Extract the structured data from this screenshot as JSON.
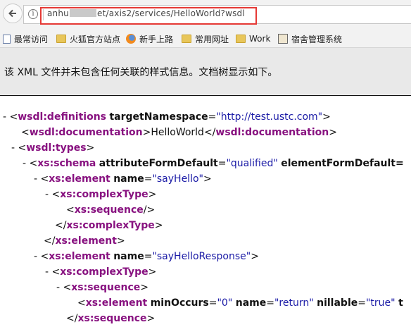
{
  "browser": {
    "url_prefix": "anhu",
    "url_suffix": "et/axis2/services/HelloWorld?wsdl"
  },
  "bookmarks": [
    {
      "label": "最常访问",
      "icon": "page-icon"
    },
    {
      "label": "火狐官方站点",
      "icon": "folder-icon"
    },
    {
      "label": "新手上路",
      "icon": "firefox-icon"
    },
    {
      "label": "常用网址",
      "icon": "folder-icon"
    },
    {
      "label": "Work",
      "icon": "folder-icon"
    },
    {
      "label": "宿舍管理系统",
      "icon": "dorm-icon"
    }
  ],
  "notice": "该 XML 文件并未包含任何关联的样式信息。文档树显示如下。",
  "xml": {
    "l1": {
      "toggle": "-",
      "open": "<",
      "tag": "wsdl:definitions",
      "a1n": "targetNamespace",
      "eq": "=",
      "a1v": "\"http://test.ustc.com\"",
      "close": ">"
    },
    "l2": {
      "open": "<",
      "tag": "wsdl:documentation",
      "gt": ">",
      "text": "HelloWorld",
      "open2": "</",
      "tag2": "wsdl:documentation",
      "close": ">"
    },
    "l3": {
      "toggle": "-",
      "open": "<",
      "tag": "wsdl:types",
      "close": ">"
    },
    "l4": {
      "toggle": "-",
      "open": "<",
      "tag": "xs:schema",
      "a1n": "attributeFormDefault",
      "eq": "=",
      "a1v": "\"qualified\"",
      "a2n": "elementFormDefault="
    },
    "l5": {
      "toggle": "-",
      "open": "<",
      "tag": "xs:element",
      "a1n": "name",
      "eq": "=",
      "a1v": "\"sayHello\"",
      "close": ">"
    },
    "l6": {
      "toggle": "-",
      "open": "<",
      "tag": "xs:complexType",
      "close": ">"
    },
    "l7": {
      "open": "<",
      "tag": "xs:sequence",
      "close": "/>"
    },
    "l8": {
      "open": "</",
      "tag": "xs:complexType",
      "close": ">"
    },
    "l9": {
      "open": "</",
      "tag": "xs:element",
      "close": ">"
    },
    "l10": {
      "toggle": "-",
      "open": "<",
      "tag": "xs:element",
      "a1n": "name",
      "eq": "=",
      "a1v": "\"sayHelloResponse\"",
      "close": ">"
    },
    "l11": {
      "toggle": "-",
      "open": "<",
      "tag": "xs:complexType",
      "close": ">"
    },
    "l12": {
      "toggle": "-",
      "open": "<",
      "tag": "xs:sequence",
      "close": ">"
    },
    "l13": {
      "open": "<",
      "tag": "xs:element",
      "a1n": "minOccurs",
      "eq": "=",
      "a1v": "\"0\"",
      "a2n": "name",
      "a2v": "\"return\"",
      "a3n": "nillable",
      "a3v": "\"true\"",
      "tail": "t"
    },
    "l14": {
      "open": "</",
      "tag": "xs:sequence",
      "close": ">"
    }
  },
  "colors": {
    "tag": "#881280",
    "attr_value": "#1a1aa6",
    "highlight_box": "#e53935"
  }
}
